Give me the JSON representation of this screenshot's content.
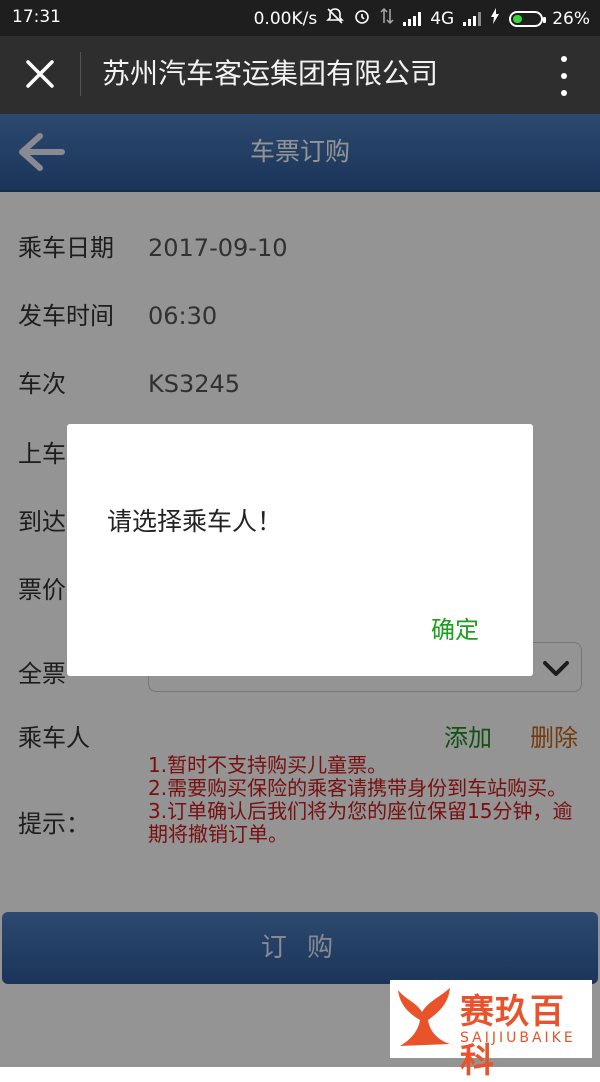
{
  "status_bar": {
    "time": "17:31",
    "speed": "0.00K/s",
    "network": "4G",
    "battery": "26%"
  },
  "app_bar": {
    "title": "苏州汽车客运集团有限公司"
  },
  "page_header": {
    "title": "车票订购"
  },
  "form": {
    "date": {
      "label": "乘车日期",
      "value": "2017-09-10"
    },
    "time": {
      "label": "发车时间",
      "value": "06:30"
    },
    "bus_no": {
      "label": "车次",
      "value": "KS3245"
    },
    "board_label": "上车",
    "arrive_label": "到达",
    "price_label": "票价",
    "ticket_type_label": "全票",
    "passenger": {
      "label": "乘车人",
      "add": "添加",
      "delete": "删除"
    },
    "tips_label": "提示：",
    "tips": [
      "1.暂时不支持购买儿童票。",
      "2.需要购买保险的乘客请携带身份到车站购买。",
      "3.订单确认后我们将为您的座位保留15分钟，逾期将撤销订单。"
    ],
    "submit": "订 购"
  },
  "dialog": {
    "message": "请选择乘车人！",
    "ok": "确定"
  },
  "watermark": {
    "cn": "赛玖百科",
    "en": "SAIJIUBAIKE"
  },
  "colors": {
    "header_blue": "#3b6bb0",
    "add_green": "#1e8c1e",
    "delete_orange": "#c86414",
    "tips_red": "#d01c1c",
    "ok_green": "#1e9e1e",
    "watermark_orange": "#e8532b"
  }
}
